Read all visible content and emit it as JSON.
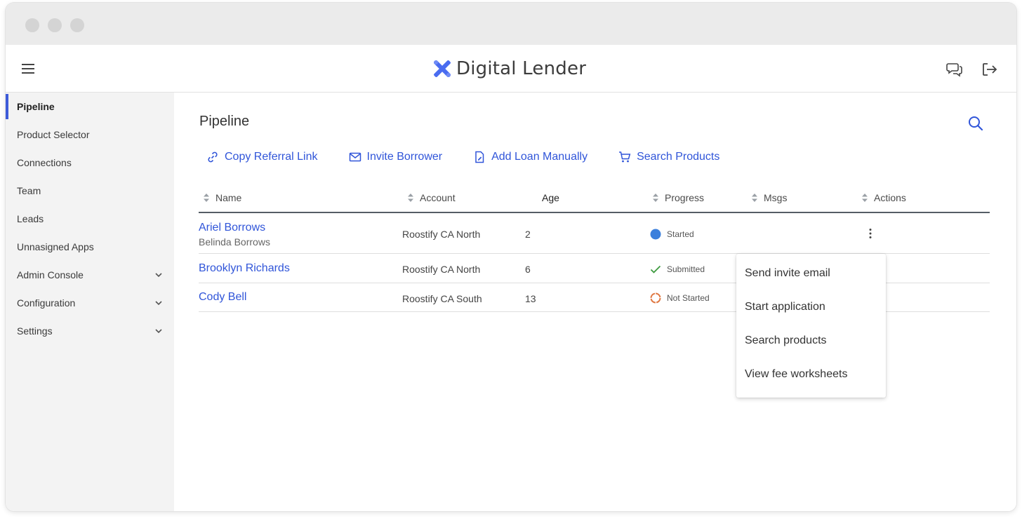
{
  "app": {
    "brand": "Digital Lender",
    "brand_color": "#4a6cf0"
  },
  "sidebar": {
    "items": [
      {
        "label": "Pipeline",
        "active": true
      },
      {
        "label": "Product Selector"
      },
      {
        "label": "Connections"
      },
      {
        "label": "Team"
      },
      {
        "label": "Leads"
      },
      {
        "label": "Unnasigned Apps"
      },
      {
        "label": "Admin Console",
        "expandable": true
      },
      {
        "label": "Configuration",
        "expandable": true
      },
      {
        "label": "Settings",
        "expandable": true
      }
    ]
  },
  "main": {
    "title": "Pipeline",
    "toolbar": {
      "copy_referral": "Copy Referral Link",
      "invite_borrower": "Invite Borrower",
      "add_loan": "Add Loan Manually",
      "search_products": "Search Products"
    },
    "table": {
      "headers": {
        "name": "Name",
        "account": "Account",
        "age": "Age",
        "progress": "Progress",
        "msgs": "Msgs",
        "actions": "Actions"
      },
      "rows": [
        {
          "name": "Ariel Borrows",
          "co_borrower": "Belinda Borrows",
          "account": "Roostify CA North",
          "age": "2",
          "progress": "Started",
          "progress_icon": "filled-circle-icon"
        },
        {
          "name": "Brooklyn Richards",
          "co_borrower": "",
          "account": "Roostify CA North",
          "age": "6",
          "progress": "Submitted",
          "progress_icon": "check-icon"
        },
        {
          "name": "Cody Bell",
          "co_borrower": "",
          "account": "Roostify CA South",
          "age": "13",
          "progress": "Not Started",
          "progress_icon": "dashed-circle-icon"
        }
      ]
    },
    "actions_menu": {
      "items": [
        "Send invite email",
        "Start application",
        "Search products",
        "View fee worksheets"
      ]
    }
  },
  "colors": {
    "accent": "#3055d9",
    "started": "#3b7fdc",
    "submitted": "#3d9a3f",
    "not_started": "#e07a45",
    "sidebar_bg": "#f3f3f3"
  }
}
